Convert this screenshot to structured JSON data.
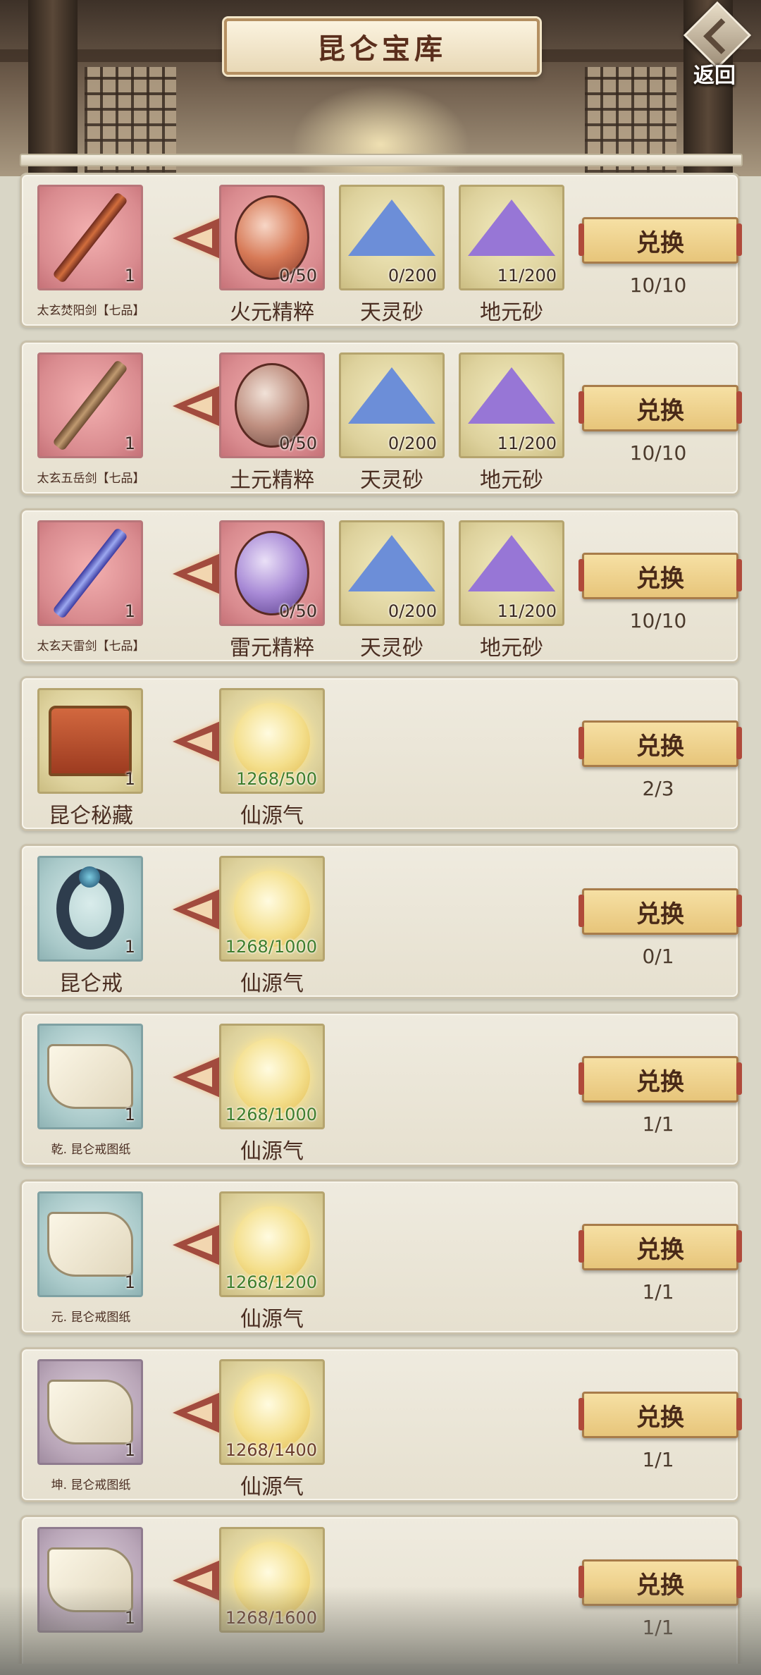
{
  "header": {
    "title": "昆仑宝库",
    "back_label": "返回"
  },
  "button_label": "兑换",
  "rows": [
    {
      "target": {
        "name": "太玄焚阳剑【七品】",
        "qty": "1",
        "color": "red",
        "icon": "fire-sword-icon"
      },
      "costs": [
        {
          "name": "火元精粹",
          "progress": "0/50",
          "color": "red",
          "icon": "fire-essence-icon"
        },
        {
          "name": "天灵砂",
          "progress": "0/200",
          "color": "yellow",
          "icon": "sky-sand-icon"
        },
        {
          "name": "地元砂",
          "progress": "11/200",
          "color": "yellow",
          "icon": "earth-sand-icon"
        }
      ],
      "limit": "10/10"
    },
    {
      "target": {
        "name": "太玄五岳剑【七品】",
        "qty": "1",
        "color": "red",
        "icon": "mountain-sword-icon"
      },
      "costs": [
        {
          "name": "土元精粹",
          "progress": "0/50",
          "color": "red",
          "icon": "earth-essence-icon"
        },
        {
          "name": "天灵砂",
          "progress": "0/200",
          "color": "yellow",
          "icon": "sky-sand-icon"
        },
        {
          "name": "地元砂",
          "progress": "11/200",
          "color": "yellow",
          "icon": "earth-sand-icon"
        }
      ],
      "limit": "10/10"
    },
    {
      "target": {
        "name": "太玄天雷剑【七品】",
        "qty": "1",
        "color": "red",
        "icon": "thunder-sword-icon"
      },
      "costs": [
        {
          "name": "雷元精粹",
          "progress": "0/50",
          "color": "red",
          "icon": "thunder-essence-icon"
        },
        {
          "name": "天灵砂",
          "progress": "0/200",
          "color": "yellow",
          "icon": "sky-sand-icon"
        },
        {
          "name": "地元砂",
          "progress": "11/200",
          "color": "yellow",
          "icon": "earth-sand-icon"
        }
      ],
      "limit": "10/10"
    },
    {
      "target": {
        "name": "昆仑秘藏",
        "qty": "1",
        "color": "yellow",
        "icon": "treasure-chest-icon"
      },
      "costs": [
        {
          "name": "仙源气",
          "progress": "1268/500",
          "color": "yellow",
          "icon": "immortal-qi-orb-icon",
          "enough": true
        }
      ],
      "limit": "2/3"
    },
    {
      "target": {
        "name": "昆仑戒",
        "qty": "1",
        "color": "teal",
        "icon": "ring-icon"
      },
      "costs": [
        {
          "name": "仙源气",
          "progress": "1268/1000",
          "color": "yellow",
          "icon": "immortal-qi-orb-icon",
          "enough": true
        }
      ],
      "limit": "0/1"
    },
    {
      "target": {
        "name": "乾. 昆仑戒图纸",
        "qty": "1",
        "color": "teal",
        "icon": "scroll-icon"
      },
      "costs": [
        {
          "name": "仙源气",
          "progress": "1268/1000",
          "color": "yellow",
          "icon": "immortal-qi-orb-icon",
          "enough": true
        }
      ],
      "limit": "1/1"
    },
    {
      "target": {
        "name": "元. 昆仑戒图纸",
        "qty": "1",
        "color": "teal",
        "icon": "scroll-icon"
      },
      "costs": [
        {
          "name": "仙源气",
          "progress": "1268/1200",
          "color": "yellow",
          "icon": "immortal-qi-orb-icon",
          "enough": true
        }
      ],
      "limit": "1/1"
    },
    {
      "target": {
        "name": "坤. 昆仑戒图纸",
        "qty": "1",
        "color": "purple",
        "icon": "scroll-icon"
      },
      "costs": [
        {
          "name": "仙源气",
          "progress": "1268/1400",
          "color": "yellow",
          "icon": "immortal-qi-orb-icon",
          "enough": false
        }
      ],
      "limit": "1/1"
    },
    {
      "target": {
        "name": "",
        "qty": "1",
        "color": "purple",
        "icon": "scroll-icon"
      },
      "costs": [
        {
          "name": "",
          "progress": "1268/1600",
          "color": "yellow",
          "icon": "immortal-qi-orb-icon",
          "enough": false
        }
      ],
      "limit": "1/1"
    }
  ]
}
